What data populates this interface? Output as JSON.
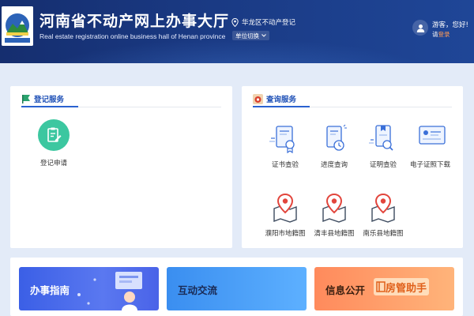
{
  "header": {
    "title": "河南省不动产网上办事大厅",
    "subtitle": "Real estate registration online business hall of Henan province",
    "location": "华龙区不动产登记",
    "unit_switch": "单位切换",
    "greeting": "游客，您好!",
    "login_prefix": "请",
    "login_link": "登录"
  },
  "registration_panel": {
    "title": "登记服务",
    "items": [
      {
        "label": "登记申请",
        "icon": "document-edit-icon"
      }
    ]
  },
  "query_panel": {
    "title": "查询服务",
    "items": [
      {
        "label": "证书查验",
        "icon": "certificate-icon"
      },
      {
        "label": "进度查询",
        "icon": "progress-clock-icon"
      },
      {
        "label": "证明查验",
        "icon": "proof-search-icon"
      },
      {
        "label": "电子证照下载",
        "icon": "e-license-icon"
      },
      {
        "label": "濮阳市地籍图",
        "icon": "map-pin-icon"
      },
      {
        "label": "清丰县地籍图",
        "icon": "map-pin-icon"
      },
      {
        "label": "南乐县地籍图",
        "icon": "map-pin-icon"
      }
    ]
  },
  "banners": {
    "guide": "办事指南",
    "interact": "互动交流",
    "info": "信息公开",
    "assistant": "房管助手"
  },
  "colors": {
    "header_blue": "#1a3a84",
    "accent_blue": "#2a62d0",
    "registration_green": "#3cc7a0",
    "map_pin_red": "#e2453c",
    "login_orange": "#ff9a55"
  }
}
